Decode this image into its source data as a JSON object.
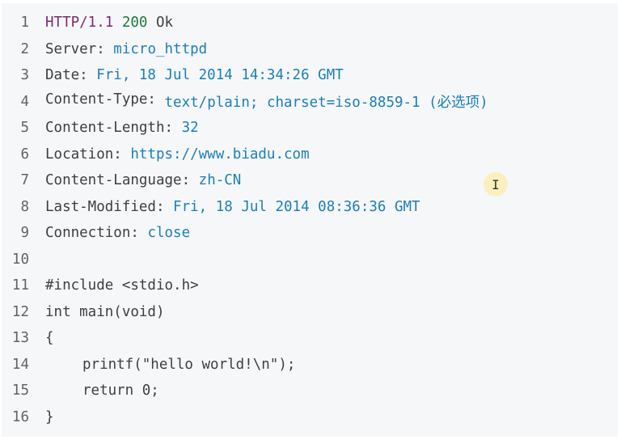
{
  "lines": [
    {
      "n": "1",
      "a": "HTTP/1.1 ",
      "b": "200",
      "c": " Ok"
    },
    {
      "n": "2",
      "key": "Server: ",
      "val": "micro_httpd"
    },
    {
      "n": "3",
      "key": "Date: ",
      "val": "Fri, 18 Jul 2014 14:34:26 GMT"
    },
    {
      "n": "4",
      "key": "Content-Type: ",
      "val": "text/plain; charset=iso-8859-1 (必选项)"
    },
    {
      "n": "5",
      "key": "Content-Length: ",
      "val": "32"
    },
    {
      "n": "6",
      "key": "Location: ",
      "val": "https://www.biadu.com"
    },
    {
      "n": "7",
      "key": "Content-Language: ",
      "val": "zh-CN"
    },
    {
      "n": "8",
      "key": "Last-Modified: ",
      "val": "Fri, 18 Jul 2014 08:36:36 GMT"
    },
    {
      "n": "9",
      "key": "Connection: ",
      "val": "close"
    },
    {
      "n": "10",
      "text": ""
    },
    {
      "n": "11",
      "text": "#include <stdio.h>"
    },
    {
      "n": "12",
      "text": "int main(void)"
    },
    {
      "n": "13",
      "text": "{"
    },
    {
      "n": "14",
      "text": "printf(\"hello world!\\n\");"
    },
    {
      "n": "15",
      "text": "return 0;"
    },
    {
      "n": "16",
      "text": "}"
    }
  ],
  "cursor_glyph": "I"
}
